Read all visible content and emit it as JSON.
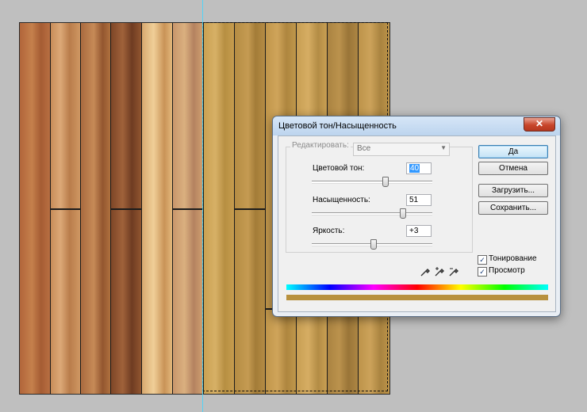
{
  "dialog": {
    "title": "Цветовой тон/Насыщенность",
    "close_symbol": "✕",
    "edit_label": "Редактировать:",
    "edit_value": "Все",
    "hue": {
      "label": "Цветовой тон:",
      "value": "40",
      "range": [
        -180,
        180
      ]
    },
    "saturation": {
      "label": "Насыщенность:",
      "value": "51",
      "range": [
        -100,
        100
      ]
    },
    "lightness": {
      "label": "Яркость:",
      "value": "+3",
      "range": [
        -100,
        100
      ]
    },
    "buttons": {
      "ok": "Да",
      "cancel": "Отмена",
      "load": "Загрузить...",
      "save": "Сохранить..."
    },
    "colorize": {
      "label": "Тонирование",
      "checked": true,
      "mark": "✓"
    },
    "preview": {
      "label": "Просмотр",
      "checked": true,
      "mark": "✓"
    },
    "icons": [
      "eyedropper-icon",
      "eyedropper-plus-icon",
      "eyedropper-minus-icon"
    ],
    "spectrum_colors": [
      "#00ffff",
      "#0000ff",
      "#ff00ff",
      "#ff0000",
      "#ffff00",
      "#00ff00",
      "#00ffff"
    ],
    "result_color": "#b8913e"
  },
  "canvas": {
    "background": "#bfbfbf",
    "guide_color": "#3fd6ff",
    "left_plank_colors": [
      "#b56a3a",
      "#c88a58",
      "#a86a3c",
      "#8c4f2c",
      "#d8a86a",
      "#c99868"
    ],
    "right_plank_colors": [
      "#c49a4c",
      "#b38b43",
      "#bb9148",
      "#c29b50",
      "#ae8641",
      "#b9924a"
    ]
  }
}
